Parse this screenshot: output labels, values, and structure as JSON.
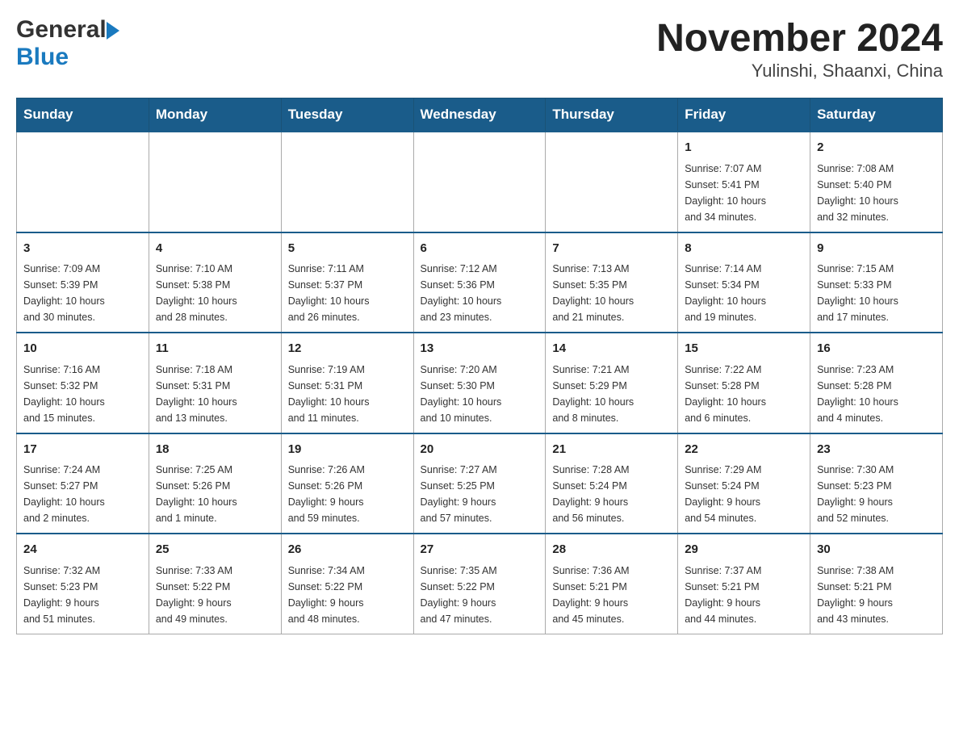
{
  "logo": {
    "general": "General",
    "blue": "Blue"
  },
  "title": "November 2024",
  "subtitle": "Yulinshi, Shaanxi, China",
  "weekdays": [
    "Sunday",
    "Monday",
    "Tuesday",
    "Wednesday",
    "Thursday",
    "Friday",
    "Saturday"
  ],
  "weeks": [
    [
      {
        "day": "",
        "info": ""
      },
      {
        "day": "",
        "info": ""
      },
      {
        "day": "",
        "info": ""
      },
      {
        "day": "",
        "info": ""
      },
      {
        "day": "",
        "info": ""
      },
      {
        "day": "1",
        "info": "Sunrise: 7:07 AM\nSunset: 5:41 PM\nDaylight: 10 hours\nand 34 minutes."
      },
      {
        "day": "2",
        "info": "Sunrise: 7:08 AM\nSunset: 5:40 PM\nDaylight: 10 hours\nand 32 minutes."
      }
    ],
    [
      {
        "day": "3",
        "info": "Sunrise: 7:09 AM\nSunset: 5:39 PM\nDaylight: 10 hours\nand 30 minutes."
      },
      {
        "day": "4",
        "info": "Sunrise: 7:10 AM\nSunset: 5:38 PM\nDaylight: 10 hours\nand 28 minutes."
      },
      {
        "day": "5",
        "info": "Sunrise: 7:11 AM\nSunset: 5:37 PM\nDaylight: 10 hours\nand 26 minutes."
      },
      {
        "day": "6",
        "info": "Sunrise: 7:12 AM\nSunset: 5:36 PM\nDaylight: 10 hours\nand 23 minutes."
      },
      {
        "day": "7",
        "info": "Sunrise: 7:13 AM\nSunset: 5:35 PM\nDaylight: 10 hours\nand 21 minutes."
      },
      {
        "day": "8",
        "info": "Sunrise: 7:14 AM\nSunset: 5:34 PM\nDaylight: 10 hours\nand 19 minutes."
      },
      {
        "day": "9",
        "info": "Sunrise: 7:15 AM\nSunset: 5:33 PM\nDaylight: 10 hours\nand 17 minutes."
      }
    ],
    [
      {
        "day": "10",
        "info": "Sunrise: 7:16 AM\nSunset: 5:32 PM\nDaylight: 10 hours\nand 15 minutes."
      },
      {
        "day": "11",
        "info": "Sunrise: 7:18 AM\nSunset: 5:31 PM\nDaylight: 10 hours\nand 13 minutes."
      },
      {
        "day": "12",
        "info": "Sunrise: 7:19 AM\nSunset: 5:31 PM\nDaylight: 10 hours\nand 11 minutes."
      },
      {
        "day": "13",
        "info": "Sunrise: 7:20 AM\nSunset: 5:30 PM\nDaylight: 10 hours\nand 10 minutes."
      },
      {
        "day": "14",
        "info": "Sunrise: 7:21 AM\nSunset: 5:29 PM\nDaylight: 10 hours\nand 8 minutes."
      },
      {
        "day": "15",
        "info": "Sunrise: 7:22 AM\nSunset: 5:28 PM\nDaylight: 10 hours\nand 6 minutes."
      },
      {
        "day": "16",
        "info": "Sunrise: 7:23 AM\nSunset: 5:28 PM\nDaylight: 10 hours\nand 4 minutes."
      }
    ],
    [
      {
        "day": "17",
        "info": "Sunrise: 7:24 AM\nSunset: 5:27 PM\nDaylight: 10 hours\nand 2 minutes."
      },
      {
        "day": "18",
        "info": "Sunrise: 7:25 AM\nSunset: 5:26 PM\nDaylight: 10 hours\nand 1 minute."
      },
      {
        "day": "19",
        "info": "Sunrise: 7:26 AM\nSunset: 5:26 PM\nDaylight: 9 hours\nand 59 minutes."
      },
      {
        "day": "20",
        "info": "Sunrise: 7:27 AM\nSunset: 5:25 PM\nDaylight: 9 hours\nand 57 minutes."
      },
      {
        "day": "21",
        "info": "Sunrise: 7:28 AM\nSunset: 5:24 PM\nDaylight: 9 hours\nand 56 minutes."
      },
      {
        "day": "22",
        "info": "Sunrise: 7:29 AM\nSunset: 5:24 PM\nDaylight: 9 hours\nand 54 minutes."
      },
      {
        "day": "23",
        "info": "Sunrise: 7:30 AM\nSunset: 5:23 PM\nDaylight: 9 hours\nand 52 minutes."
      }
    ],
    [
      {
        "day": "24",
        "info": "Sunrise: 7:32 AM\nSunset: 5:23 PM\nDaylight: 9 hours\nand 51 minutes."
      },
      {
        "day": "25",
        "info": "Sunrise: 7:33 AM\nSunset: 5:22 PM\nDaylight: 9 hours\nand 49 minutes."
      },
      {
        "day": "26",
        "info": "Sunrise: 7:34 AM\nSunset: 5:22 PM\nDaylight: 9 hours\nand 48 minutes."
      },
      {
        "day": "27",
        "info": "Sunrise: 7:35 AM\nSunset: 5:22 PM\nDaylight: 9 hours\nand 47 minutes."
      },
      {
        "day": "28",
        "info": "Sunrise: 7:36 AM\nSunset: 5:21 PM\nDaylight: 9 hours\nand 45 minutes."
      },
      {
        "day": "29",
        "info": "Sunrise: 7:37 AM\nSunset: 5:21 PM\nDaylight: 9 hours\nand 44 minutes."
      },
      {
        "day": "30",
        "info": "Sunrise: 7:38 AM\nSunset: 5:21 PM\nDaylight: 9 hours\nand 43 minutes."
      }
    ]
  ]
}
